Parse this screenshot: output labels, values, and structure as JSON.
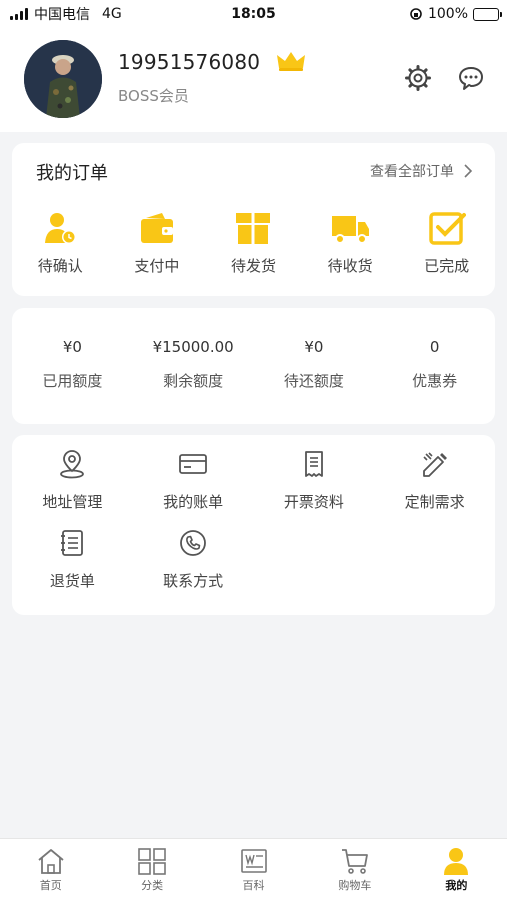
{
  "status_bar": {
    "carrier": "中国电信",
    "network": "4G",
    "time": "18:05",
    "battery": "100%"
  },
  "profile": {
    "phone": "19951576080",
    "member_level": "BOSS会员",
    "crown_icon": "crown-icon",
    "settings_icon": "gear-icon",
    "message_icon": "chat-bubble-icon"
  },
  "orders": {
    "title": "我的订单",
    "view_all": "查看全部订单",
    "items": [
      {
        "label": "待确认",
        "icon": "user-clock-icon"
      },
      {
        "label": "支付中",
        "icon": "wallet-icon"
      },
      {
        "label": "待发货",
        "icon": "gift-box-icon"
      },
      {
        "label": "待收货",
        "icon": "truck-icon"
      },
      {
        "label": "已完成",
        "icon": "check-square-icon"
      }
    ]
  },
  "quota": [
    {
      "value": "¥0",
      "label": "已用额度"
    },
    {
      "value": "¥15000.00",
      "label": "剩余额度"
    },
    {
      "value": "¥0",
      "label": "待还额度"
    },
    {
      "value": "0",
      "label": "优惠券"
    }
  ],
  "tools": [
    {
      "label": "地址管理",
      "icon": "location-pin-icon"
    },
    {
      "label": "我的账单",
      "icon": "credit-card-icon"
    },
    {
      "label": "开票资料",
      "icon": "receipt-icon"
    },
    {
      "label": "定制需求",
      "icon": "pencil-ruler-icon"
    },
    {
      "label": "退货单",
      "icon": "notebook-icon"
    },
    {
      "label": "联系方式",
      "icon": "phone-icon"
    }
  ],
  "tabbar": [
    {
      "label": "首页",
      "icon": "home-icon",
      "active": false
    },
    {
      "label": "分类",
      "icon": "grid-icon",
      "active": false
    },
    {
      "label": "百科",
      "icon": "encyclopedia-icon",
      "active": false
    },
    {
      "label": "购物车",
      "icon": "cart-icon",
      "active": false
    },
    {
      "label": "我的",
      "icon": "user-icon",
      "active": true
    }
  ],
  "colors": {
    "accent": "#f9c616",
    "background": "#f3f4f6",
    "card": "#ffffff"
  }
}
